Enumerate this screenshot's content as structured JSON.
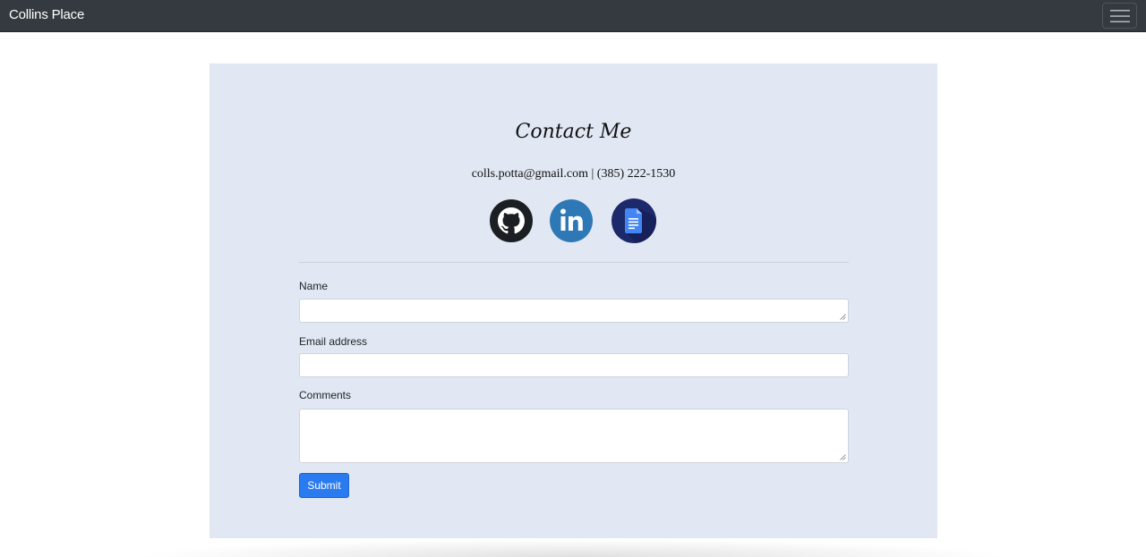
{
  "navbar": {
    "brand": "Collins Place",
    "menu_icon": "hamburger-icon",
    "background": "#343a40"
  },
  "contact": {
    "title": "Contact Me",
    "info": "colls.potta@gmail.com | (385) 222-1530",
    "background": "#e1e8f3",
    "social": [
      {
        "icon": "github-icon"
      },
      {
        "icon": "linkedin-icon"
      },
      {
        "icon": "google-docs-icon"
      }
    ]
  },
  "form": {
    "name_label": "Name",
    "name_value": "",
    "email_label": "Email address",
    "email_value": "",
    "comments_label": "Comments",
    "comments_value": "",
    "submit_label": "Submit",
    "accent": "#2a7bef"
  }
}
